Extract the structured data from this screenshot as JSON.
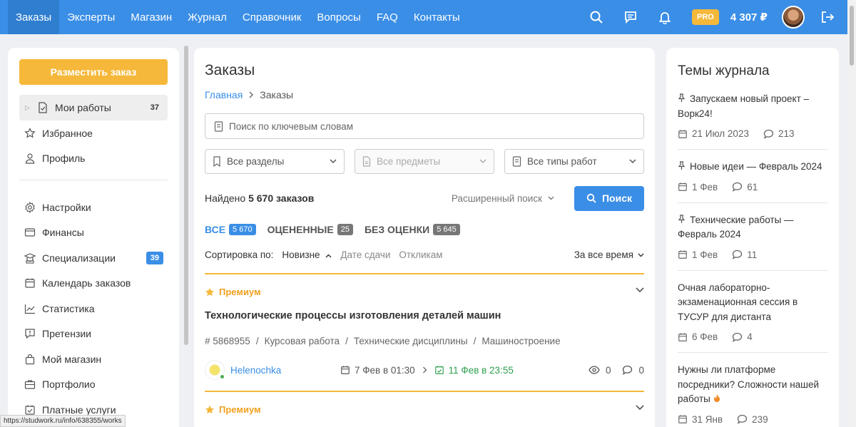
{
  "nav": {
    "items": [
      "Заказы",
      "Эксперты",
      "Магазин",
      "Журнал",
      "Справочник",
      "Вопросы",
      "FAQ",
      "Контакты"
    ],
    "pro": "PRO",
    "balance": "4 307 ₽"
  },
  "sidebar": {
    "place_order": "Разместить заказ",
    "items": [
      {
        "label": "Мои работы",
        "count": "37",
        "icon": "document-check-icon"
      },
      {
        "label": "Избранное",
        "icon": "star-icon"
      },
      {
        "label": "Профиль",
        "icon": "user-icon"
      },
      {
        "label": "Настройки",
        "icon": "gear-icon"
      },
      {
        "label": "Финансы",
        "icon": "wallet-icon"
      },
      {
        "label": "Специализации",
        "count": "39",
        "icon": "graduation-icon"
      },
      {
        "label": "Календарь заказов",
        "icon": "calendar-icon"
      },
      {
        "label": "Статистика",
        "icon": "chart-icon"
      },
      {
        "label": "Претензии",
        "icon": "alert-bubble-icon"
      },
      {
        "label": "Мой магазин",
        "icon": "bag-icon"
      },
      {
        "label": "Портфолио",
        "icon": "briefcase-icon"
      },
      {
        "label": "Платные услуги",
        "icon": "paid-icon"
      }
    ]
  },
  "main": {
    "title": "Заказы",
    "breadcrumb": {
      "home": "Главная",
      "current": "Заказы"
    },
    "search_placeholder": "Поиск по ключевым словам",
    "filters": [
      "Все разделы",
      "Все предметы",
      "Все типы работ"
    ],
    "found_prefix": "Найдено",
    "found_count": "5 670",
    "found_suffix": "заказов",
    "advanced_search": "Расширенный поиск",
    "search_button": "Поиск",
    "tabs": [
      {
        "label": "ВСЕ",
        "count": "5 670"
      },
      {
        "label": "ОЦЕНЕННЫЕ",
        "count": "25"
      },
      {
        "label": "БЕЗ ОЦЕНКИ",
        "count": "5 645"
      }
    ],
    "sort": {
      "label": "Сортировка по:",
      "options": [
        "Новизне",
        "Дате сдачи",
        "Откликам"
      ],
      "period": "За все время"
    },
    "orders": [
      {
        "badge": "Премиум",
        "title": "Технологические процессы изготовления деталей машин",
        "meta": [
          "# 5868955",
          "Курсовая работа",
          "Технические дисциплины",
          "Машиностроение"
        ],
        "user": "Helenochka",
        "date_from": "7 Фев в 01:30",
        "date_to": "11 Фев в 23:55",
        "views": "0",
        "responses": "0"
      },
      {
        "badge": "Премиум"
      }
    ]
  },
  "journal": {
    "title": "Темы журнала",
    "topics": [
      {
        "title": "Запускаем новый проект – Ворк24!",
        "date": "21 Июл 2023",
        "comments": "213",
        "pinned": true
      },
      {
        "title": "Новые идеи — Февраль 2024",
        "date": "1 Фев",
        "comments": "61",
        "pinned": true
      },
      {
        "title": "Технические работы — Февраль 2024",
        "date": "1 Фев",
        "comments": "11",
        "pinned": true
      },
      {
        "title": "Очная лабораторно-экзаменационная сессия в ТУСУР для дистанта",
        "date": "6 Фев",
        "comments": "4",
        "pinned": false
      },
      {
        "title": "Нужны ли платформе посредники? Сложности нашей работы",
        "date": "31 Янв",
        "comments": "239",
        "pinned": false
      }
    ]
  },
  "status_url": "https://studwork.ru/info/638355/works",
  "colors": {
    "primary": "#3a8ee6",
    "accent": "#f5b83a",
    "success": "#2e9e4f"
  }
}
